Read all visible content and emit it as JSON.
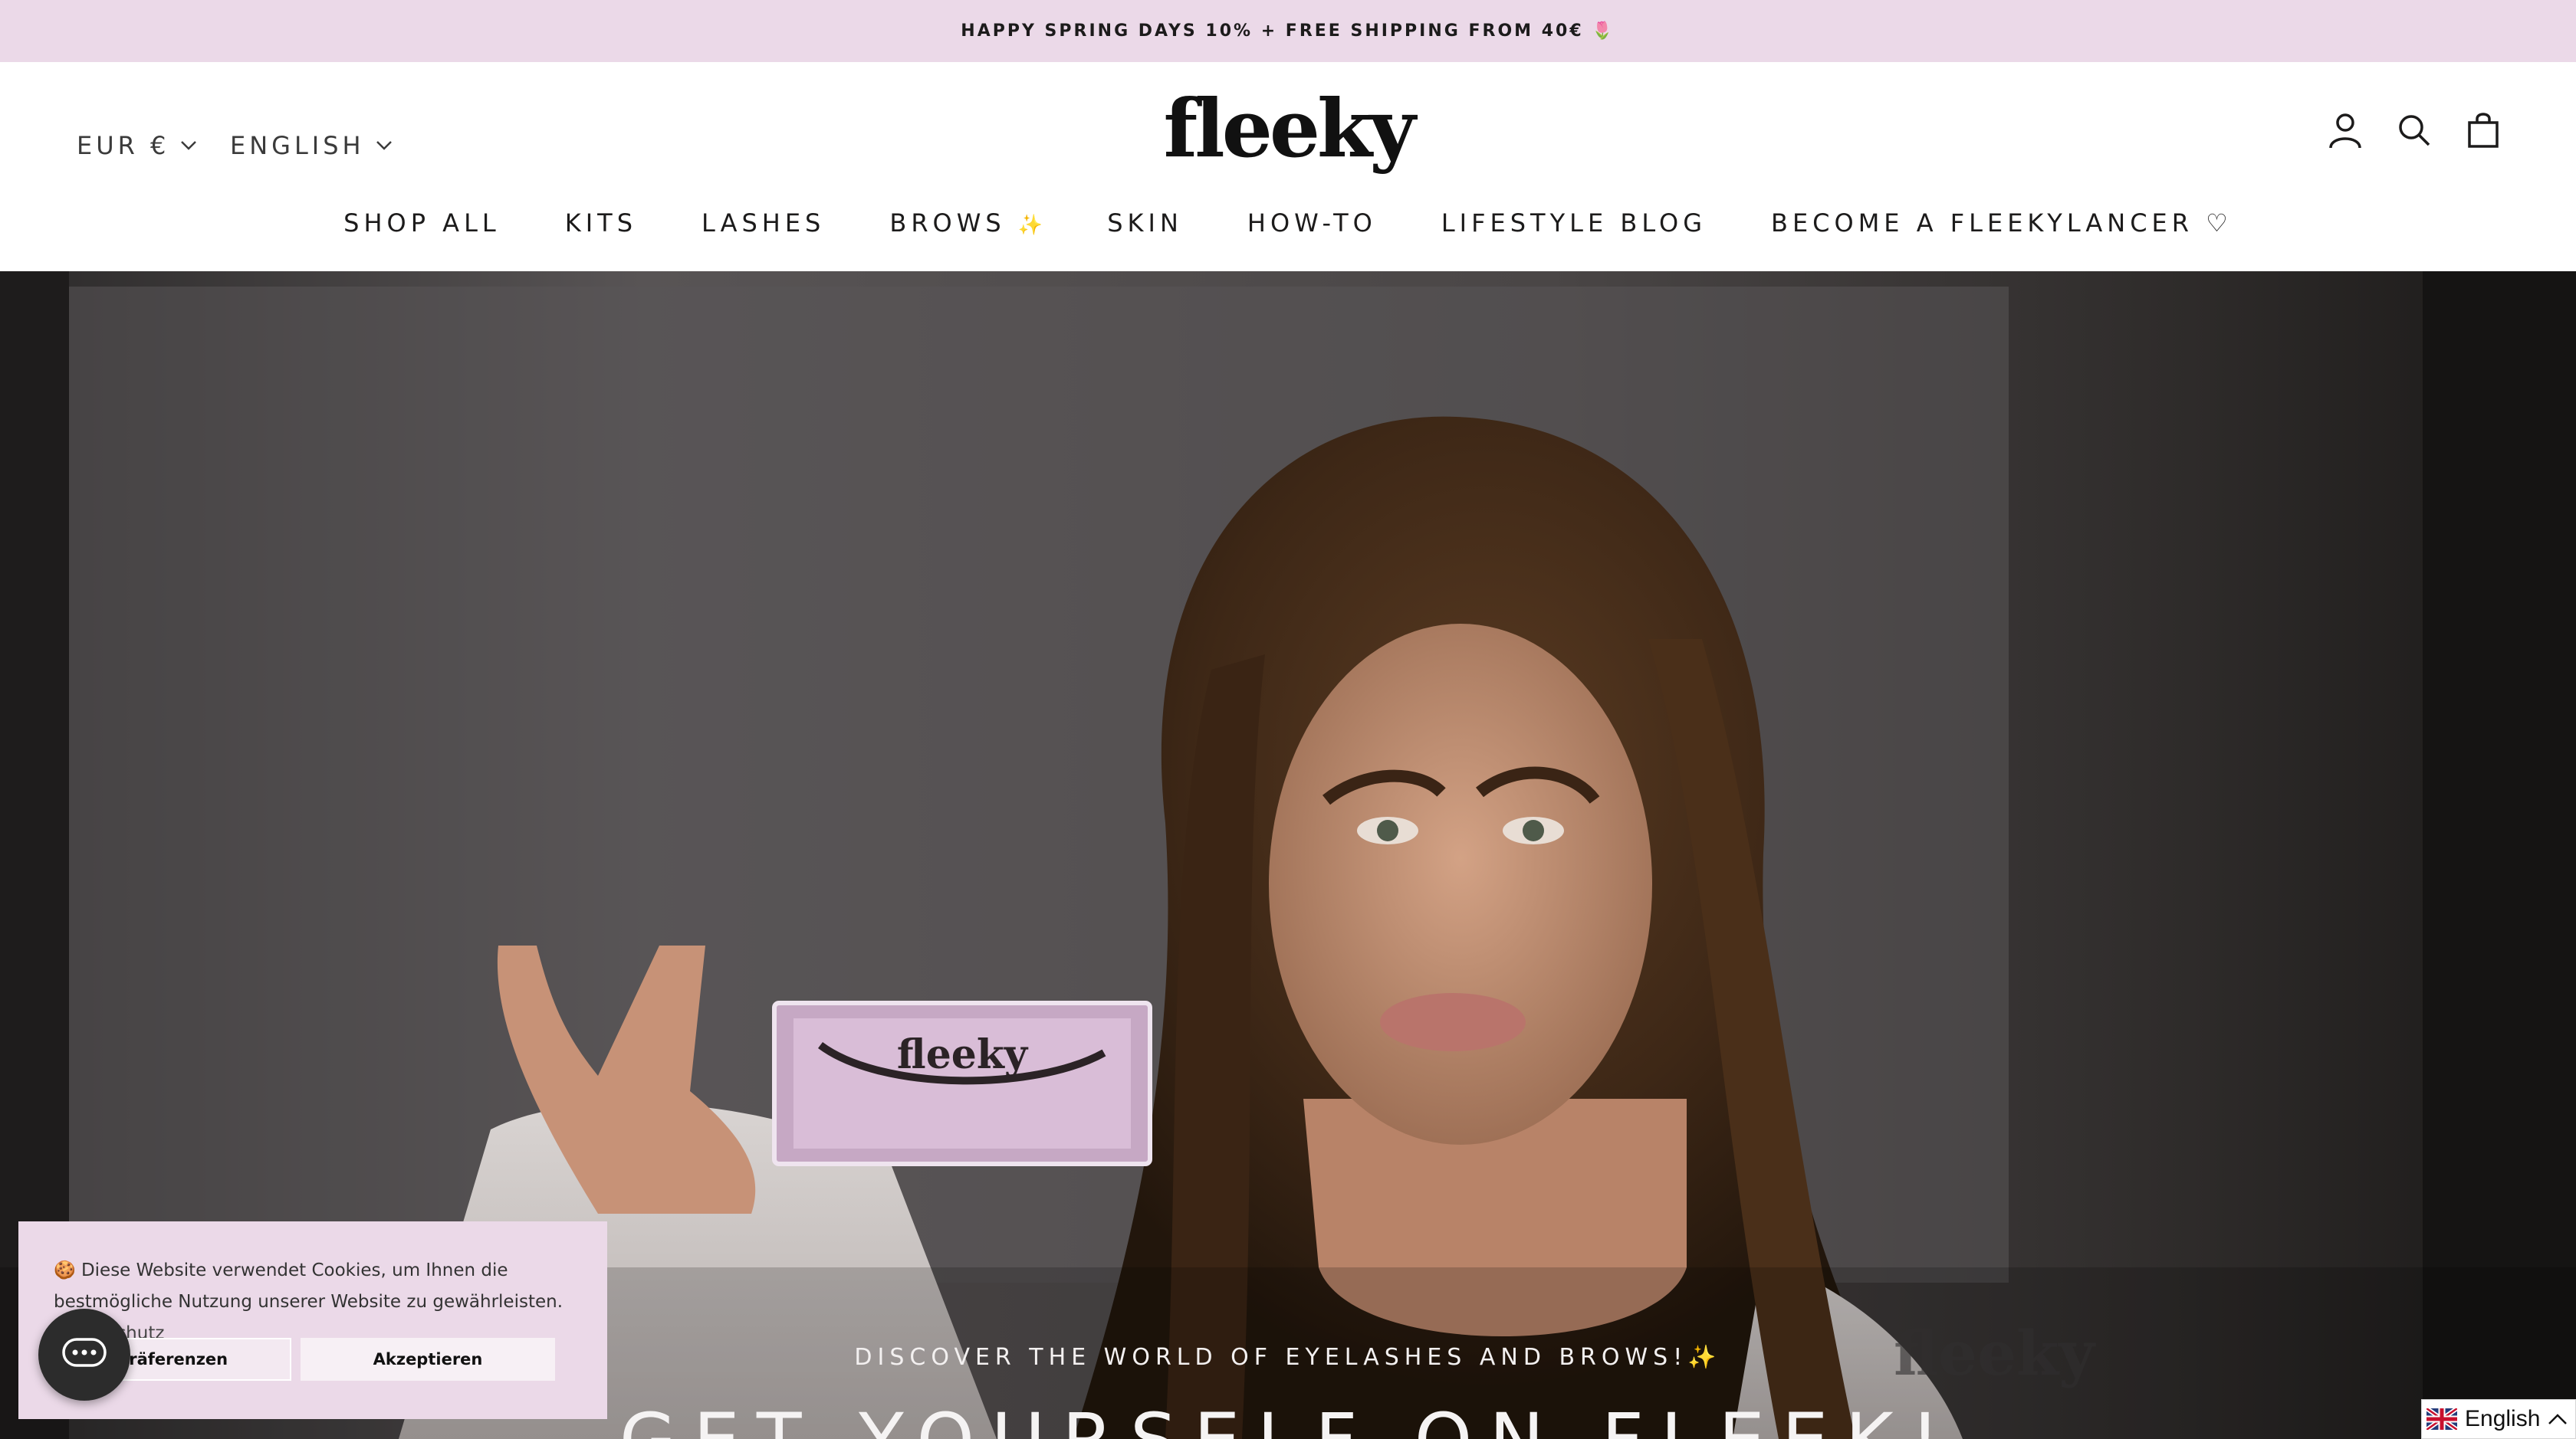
{
  "announcement": {
    "text": "HAPPY SPRING DAYS 10% + FREE SHIPPING FROM 40€ 🌷"
  },
  "header": {
    "currency": "EUR €",
    "language": "ENGLISH",
    "logo_text": "fleeky",
    "icons": [
      "account-icon",
      "search-icon",
      "cart-icon"
    ]
  },
  "nav": {
    "items": [
      {
        "label": "SHOP ALL"
      },
      {
        "label": "KITS"
      },
      {
        "label": "LASHES"
      },
      {
        "label": "BROWS",
        "badge": "✨"
      },
      {
        "label": "SKIN"
      },
      {
        "label": "HOW-TO"
      },
      {
        "label": "LIFESTYLE BLOG"
      },
      {
        "label": "BECOME A FLEEKYLANCER ♡"
      }
    ]
  },
  "hero": {
    "subtitle": "DISCOVER THE WORLD OF EYELASHES AND BROWS!✨",
    "title": "GET YOURSELF ON FLEEK!",
    "box_logo": "fleeky"
  },
  "cookie_banner": {
    "text": "🍪 Diese Website verwendet Cookies, um Ihnen die bestmögliche Nutzung unserer Website zu gewährleisten.",
    "link": "Datenschutz",
    "preferences_label": "Präferenzen",
    "accept_label": "Akzeptieren"
  },
  "language_widget": {
    "label": "English"
  },
  "colors": {
    "announcement_bg": "#ebd9e8",
    "cookie_bg": "#ebd9e8",
    "text": "#1c1b1b"
  }
}
